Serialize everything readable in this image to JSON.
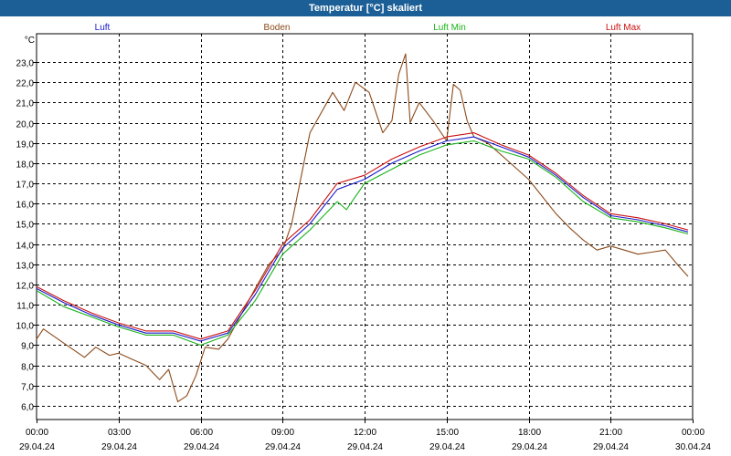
{
  "window": {
    "title": "Temperatur [°C] skaliert"
  },
  "colors": {
    "titlebar": "#1c5f96",
    "luft": "#1a1acc",
    "boden": "#8b4a1a",
    "luft_min": "#19b319",
    "luft_max": "#cc1010",
    "grid": "#000000"
  },
  "chart_data": {
    "type": "line",
    "title": "Temperatur [°C] skaliert",
    "ylabel": "°C",
    "ylim": [
      5,
      24
    ],
    "xlim": [
      "29.04.24 00:00",
      "30.04.24 00:00"
    ],
    "grid": true,
    "legend_placement": "top",
    "y_ticks": [
      "6,0",
      "7,0",
      "8,0",
      "9,0",
      "10,0",
      "11,0",
      "12,0",
      "13,0",
      "14,0",
      "15,0",
      "16,0",
      "17,0",
      "18,0",
      "19,0",
      "20,0",
      "21,0",
      "22,0",
      "23,0"
    ],
    "x_ticks": [
      {
        "time": "00:00",
        "date": "29.04.24"
      },
      {
        "time": "03:00",
        "date": "29.04.24"
      },
      {
        "time": "06:00",
        "date": "29.04.24"
      },
      {
        "time": "09:00",
        "date": "29.04.24"
      },
      {
        "time": "12:00",
        "date": "29.04.24"
      },
      {
        "time": "15:00",
        "date": "29.04.24"
      },
      {
        "time": "18:00",
        "date": "29.04.24"
      },
      {
        "time": "21:00",
        "date": "29.04.24"
      },
      {
        "time": "00:00",
        "date": "30.04.24"
      }
    ],
    "series": [
      {
        "name": "Luft",
        "color": "#1a1acc",
        "x": [
          "00:00",
          "01:00",
          "02:00",
          "03:00",
          "04:00",
          "05:00",
          "06:00",
          "07:00",
          "08:00",
          "09:00",
          "10:00",
          "11:00",
          "12:00",
          "13:00",
          "14:00",
          "15:00",
          "16:00",
          "17:00",
          "18:00",
          "19:00",
          "20:00",
          "21:00",
          "22:00",
          "23:00",
          "23:50"
        ],
        "y": [
          11.8,
          11.1,
          10.5,
          10.0,
          9.6,
          9.6,
          9.2,
          9.6,
          11.5,
          13.8,
          15.0,
          16.7,
          17.2,
          18.0,
          18.6,
          19.1,
          19.3,
          18.8,
          18.3,
          17.4,
          16.3,
          15.4,
          15.2,
          14.9,
          14.6
        ]
      },
      {
        "name": "Boden",
        "color": "#8b4a1a",
        "x": [
          "00:00",
          "00:15",
          "01:00",
          "01:45",
          "02:10",
          "02:40",
          "03:00",
          "03:30",
          "04:00",
          "04:30",
          "04:50",
          "05:10",
          "05:30",
          "05:50",
          "06:10",
          "06:40",
          "07:00",
          "08:00",
          "08:30",
          "09:00",
          "09:20",
          "10:00",
          "10:50",
          "11:15",
          "11:40",
          "12:10",
          "12:40",
          "13:00",
          "13:15",
          "13:30",
          "13:40",
          "14:00",
          "14:30",
          "15:00",
          "15:15",
          "15:30",
          "15:45",
          "16:00",
          "16:30",
          "17:00",
          "18:00",
          "19:00",
          "19:30",
          "20:00",
          "20:30",
          "21:00",
          "21:30",
          "22:00",
          "22:30",
          "23:00",
          "23:30",
          "23:50"
        ],
        "y": [
          9.3,
          9.8,
          9.1,
          8.4,
          8.9,
          8.5,
          8.6,
          8.3,
          8.0,
          7.3,
          7.8,
          6.2,
          6.5,
          7.5,
          8.9,
          8.8,
          9.3,
          11.8,
          13.0,
          13.7,
          15.0,
          19.5,
          21.5,
          20.6,
          22.0,
          21.5,
          19.5,
          20.1,
          22.4,
          23.4,
          20.0,
          21.0,
          20.1,
          19.1,
          21.9,
          21.6,
          20.1,
          19.3,
          19.0,
          18.4,
          17.2,
          15.5,
          14.8,
          14.2,
          13.7,
          13.9,
          13.7,
          13.5,
          13.6,
          13.7,
          12.9,
          12.4
        ]
      },
      {
        "name": "Luft Min",
        "color": "#19b319",
        "x": [
          "00:00",
          "01:00",
          "02:00",
          "03:00",
          "04:00",
          "05:00",
          "06:00",
          "07:00",
          "08:00",
          "09:00",
          "10:00",
          "11:00",
          "11:20",
          "12:00",
          "13:00",
          "14:00",
          "15:00",
          "16:00",
          "17:00",
          "18:00",
          "19:00",
          "20:00",
          "21:00",
          "22:00",
          "23:00",
          "23:50"
        ],
        "y": [
          11.7,
          10.9,
          10.4,
          9.9,
          9.5,
          9.5,
          9.0,
          9.5,
          11.2,
          13.5,
          14.7,
          16.1,
          15.7,
          17.0,
          17.7,
          18.4,
          18.9,
          19.1,
          18.6,
          18.2,
          17.3,
          16.1,
          15.3,
          15.1,
          14.8,
          14.5
        ]
      },
      {
        "name": "Luft Max",
        "color": "#cc1010",
        "x": [
          "00:00",
          "01:00",
          "02:00",
          "03:00",
          "04:00",
          "05:00",
          "06:00",
          "07:00",
          "08:00",
          "09:00",
          "10:00",
          "11:00",
          "12:00",
          "13:00",
          "14:00",
          "15:00",
          "16:00",
          "17:00",
          "18:00",
          "19:00",
          "20:00",
          "21:00",
          "22:00",
          "23:00",
          "23:50"
        ],
        "y": [
          11.9,
          11.2,
          10.6,
          10.1,
          9.7,
          9.7,
          9.3,
          9.7,
          11.7,
          14.0,
          15.2,
          17.0,
          17.4,
          18.2,
          18.8,
          19.3,
          19.5,
          18.9,
          18.4,
          17.5,
          16.4,
          15.5,
          15.3,
          15.0,
          14.7
        ]
      }
    ]
  }
}
